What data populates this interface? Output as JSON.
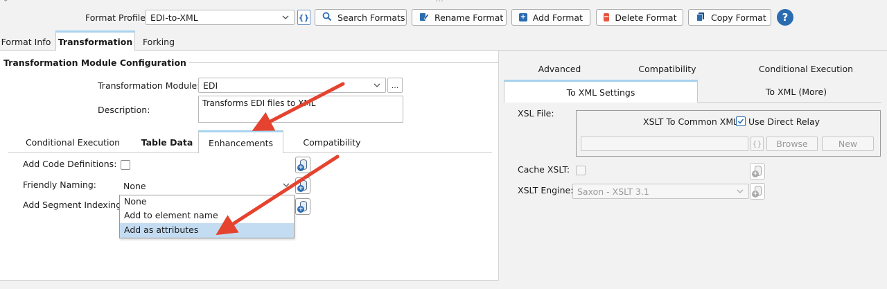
{
  "toolbar": {
    "profile_label": "Format Profile:",
    "profile_value": "EDI-to-XML",
    "json_icon_label": "{}",
    "search_label": "Search Formats",
    "rename_label": "Rename Format",
    "add_label": "Add Format",
    "delete_label": "Delete Format",
    "copy_label": "Copy Format",
    "help_label": "?"
  },
  "main_tabs": [
    {
      "label": "Format Info"
    },
    {
      "label": "Transformation"
    },
    {
      "label": "Forking"
    }
  ],
  "left_panel": {
    "group_title": "Transformation Module Configuration",
    "module_label": "Transformation Module:",
    "module_value": "EDI",
    "module_browse": "...",
    "description_label": "Description:",
    "description_value": "Transforms EDI files to XML",
    "sub_tabs": [
      {
        "label": "Conditional Execution"
      },
      {
        "label": "Table Data"
      },
      {
        "label": "Enhancements"
      },
      {
        "label": "Compatibility"
      }
    ],
    "add_code_label": "Add Code Definitions:",
    "friendly_label": "Friendly Naming:",
    "friendly_value": "None",
    "segment_label": "Add Segment Indexing:",
    "dropdown_options": [
      "None",
      "Add to element name",
      "Add as attributes"
    ]
  },
  "right_panel": {
    "tabs_top": [
      {
        "label": "Advanced"
      },
      {
        "label": "Compatibility"
      },
      {
        "label": "Conditional Execution"
      }
    ],
    "tabs_bottom": [
      {
        "label": "To XML Settings"
      },
      {
        "label": "To XML (More)"
      }
    ],
    "xsl_file_label": "XSL File:",
    "xslt_common_label": "XSLT To Common XML:",
    "direct_relay_label": "Use Direct Relay",
    "browse_label": "Browse",
    "new_label": "New",
    "json_icon_label": "{}",
    "cache_label": "Cache XSLT:",
    "engine_label": "XSLT Engine:",
    "engine_value": "Saxon - XSLT 3.1"
  },
  "colors": {
    "arrow": "#e5432f",
    "accent_blue": "#2b6cb0",
    "selected_option": "#c4dcf2",
    "delete_red": "#e8553f"
  }
}
